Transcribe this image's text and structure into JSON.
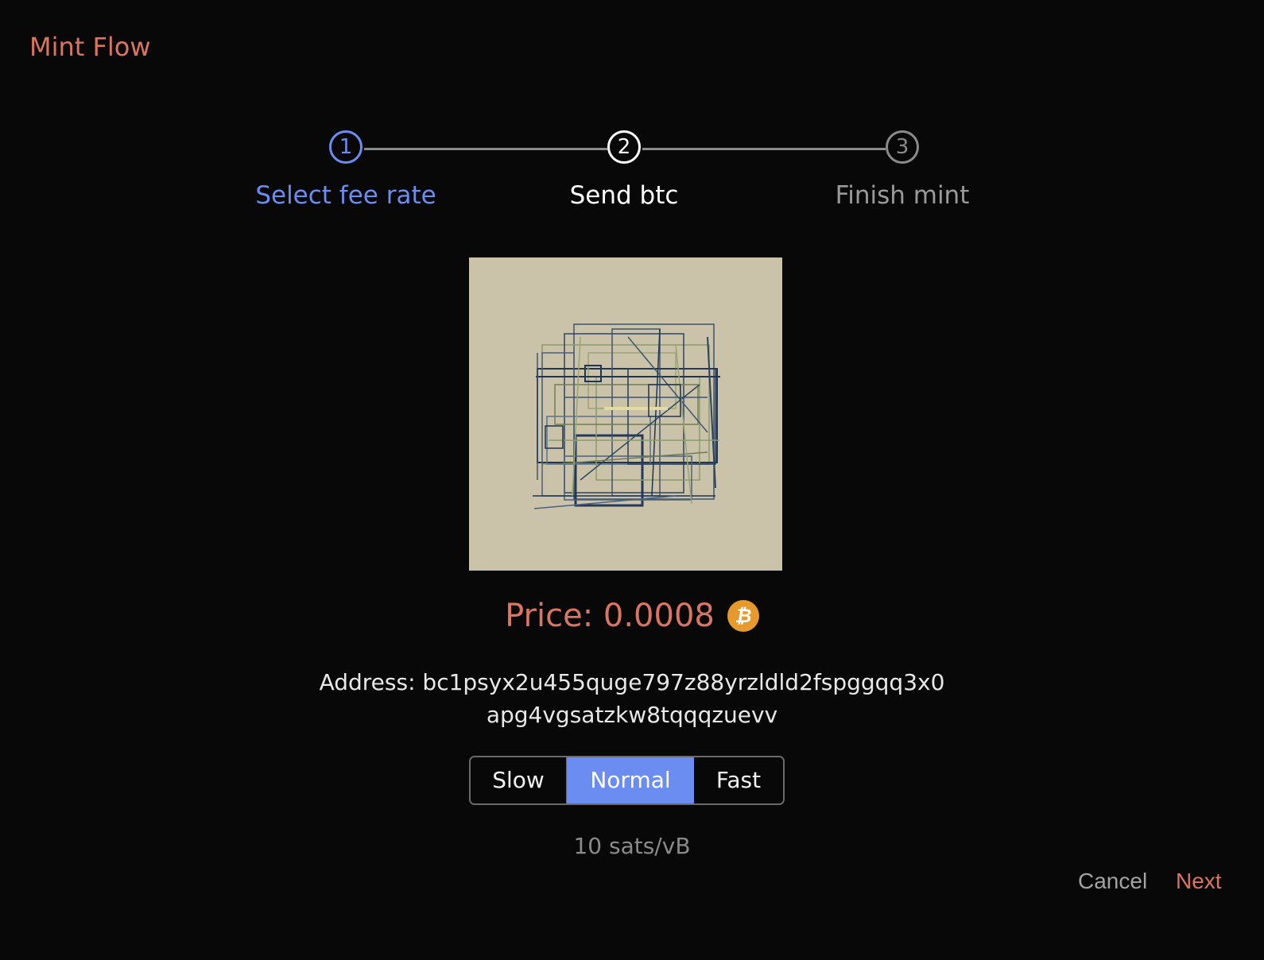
{
  "header": {
    "title": "Mint Flow"
  },
  "stepper": {
    "steps": [
      {
        "number": "1",
        "label": "Select fee rate",
        "state": "completed"
      },
      {
        "number": "2",
        "label": "Send btc",
        "state": "active"
      },
      {
        "number": "3",
        "label": "Finish mint",
        "state": "pending"
      }
    ]
  },
  "price": {
    "label": "Price: 0.0008",
    "currency_icon": "bitcoin-icon",
    "icon_glyph": "₿"
  },
  "address": {
    "text": "Address: bc1psyx2u455quge797z88yrzldld2fspggqq3x0apg4vgsatzkw8tqqqzuevv"
  },
  "fee_speed": {
    "options": [
      "Slow",
      "Normal",
      "Fast"
    ],
    "selected": "Normal",
    "rate": "10 sats/vB"
  },
  "footer": {
    "cancel_label": "Cancel",
    "next_label": "Next"
  },
  "colors": {
    "background": "#080808",
    "accent": "#d97561",
    "step_blue": "#6b8cf0",
    "bitcoin": "#e69a2b"
  }
}
